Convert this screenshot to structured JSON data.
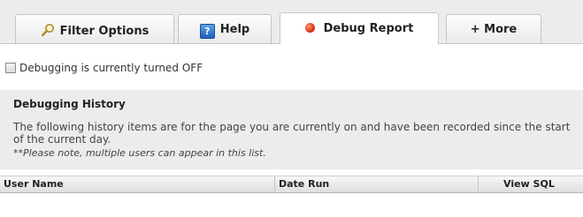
{
  "tabs": [
    {
      "label": "Filter Options",
      "icon": "magnifier-icon"
    },
    {
      "label": "Help",
      "icon": "help-icon",
      "icon_glyph": "?"
    },
    {
      "label": "Debug Report",
      "icon": "red-dot-icon"
    },
    {
      "label": "+ More",
      "icon": null
    }
  ],
  "active_tab": "Debug Report",
  "debug": {
    "checkbox_checked": false,
    "status_text": "Debugging is currently turned OFF"
  },
  "history": {
    "title": "Debugging History",
    "description": "The following history items are for the page you are currently on and have been recorded since the start of the current day.",
    "note": "**Please note, multiple users can appear in this list."
  },
  "table": {
    "columns": [
      "User Name",
      "Date Run",
      "View SQL"
    ],
    "rows": []
  },
  "colors": {
    "panel_bg": "#ececec",
    "active_tab_bg": "#ffffff",
    "help_icon_blue": "#2a6fc9",
    "debug_dot_red": "#e0301a"
  }
}
